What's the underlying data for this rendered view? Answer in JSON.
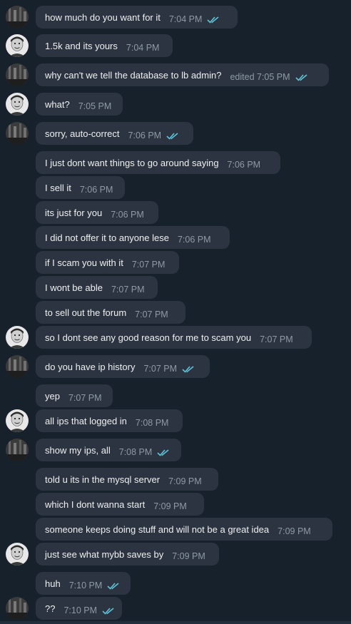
{
  "messages": [
    {
      "text": "how much do you want for it",
      "time": "7:04 PM",
      "read": true,
      "avatar": "dark"
    },
    {
      "text": "1.5k and its yours",
      "time": "7:04 PM",
      "read": false,
      "avatar": "face"
    },
    {
      "text": "why can't we tell the database to lb admin?",
      "time": "edited 7:05 PM",
      "read": true,
      "avatar": "dark"
    },
    {
      "text": "what?",
      "time": "7:05 PM",
      "read": false,
      "avatar": "face"
    },
    {
      "text": "sorry, auto-correct",
      "time": "7:06 PM",
      "read": true,
      "avatar": "dark"
    },
    {
      "text": "I just dont want things to go around saying",
      "time": "7:06 PM",
      "read": false,
      "avatar": ""
    },
    {
      "text": "I sell it",
      "time": "7:06 PM",
      "read": false,
      "avatar": ""
    },
    {
      "text": "its just for you",
      "time": "7:06 PM",
      "read": false,
      "avatar": ""
    },
    {
      "text": "I did not offer it to anyone lese",
      "time": "7:06 PM",
      "read": false,
      "avatar": ""
    },
    {
      "text": "if I scam you with it",
      "time": "7:07 PM",
      "read": false,
      "avatar": ""
    },
    {
      "text": "I wont be able",
      "time": "7:07 PM",
      "read": false,
      "avatar": ""
    },
    {
      "text": "to sell out the forum",
      "time": "7:07 PM",
      "read": false,
      "avatar": ""
    },
    {
      "text": "so I dont see any good reason for me to scam you",
      "time": "7:07 PM",
      "read": false,
      "avatar": "face"
    },
    {
      "text": "do you have ip history",
      "time": "7:07 PM",
      "read": true,
      "avatar": "dark"
    },
    {
      "text": "yep",
      "time": "7:07 PM",
      "read": false,
      "avatar": ""
    },
    {
      "text": "all ips that logged in",
      "time": "7:08 PM",
      "read": false,
      "avatar": "face"
    },
    {
      "text": "show my ips, all",
      "time": "7:08 PM",
      "read": true,
      "avatar": "dark"
    },
    {
      "text": "told u its in the mysql server",
      "time": "7:09 PM",
      "read": false,
      "avatar": ""
    },
    {
      "text": "which I dont wanna start",
      "time": "7:09 PM",
      "read": false,
      "avatar": ""
    },
    {
      "text": "someone keeps doing stuff and will not be a great idea",
      "time": "7:09 PM",
      "read": false,
      "avatar": ""
    },
    {
      "text": "just see what mybb saves by",
      "time": "7:09 PM",
      "read": false,
      "avatar": "face"
    },
    {
      "text": "huh",
      "time": "7:10 PM",
      "read": true,
      "avatar": ""
    },
    {
      "text": "??",
      "time": "7:10 PM",
      "read": true,
      "avatar": "dark"
    }
  ],
  "colors": {
    "background": "#17212b",
    "bubble": "#2b3440",
    "check": "#5fc4d9",
    "time": "#8e9aa6"
  }
}
